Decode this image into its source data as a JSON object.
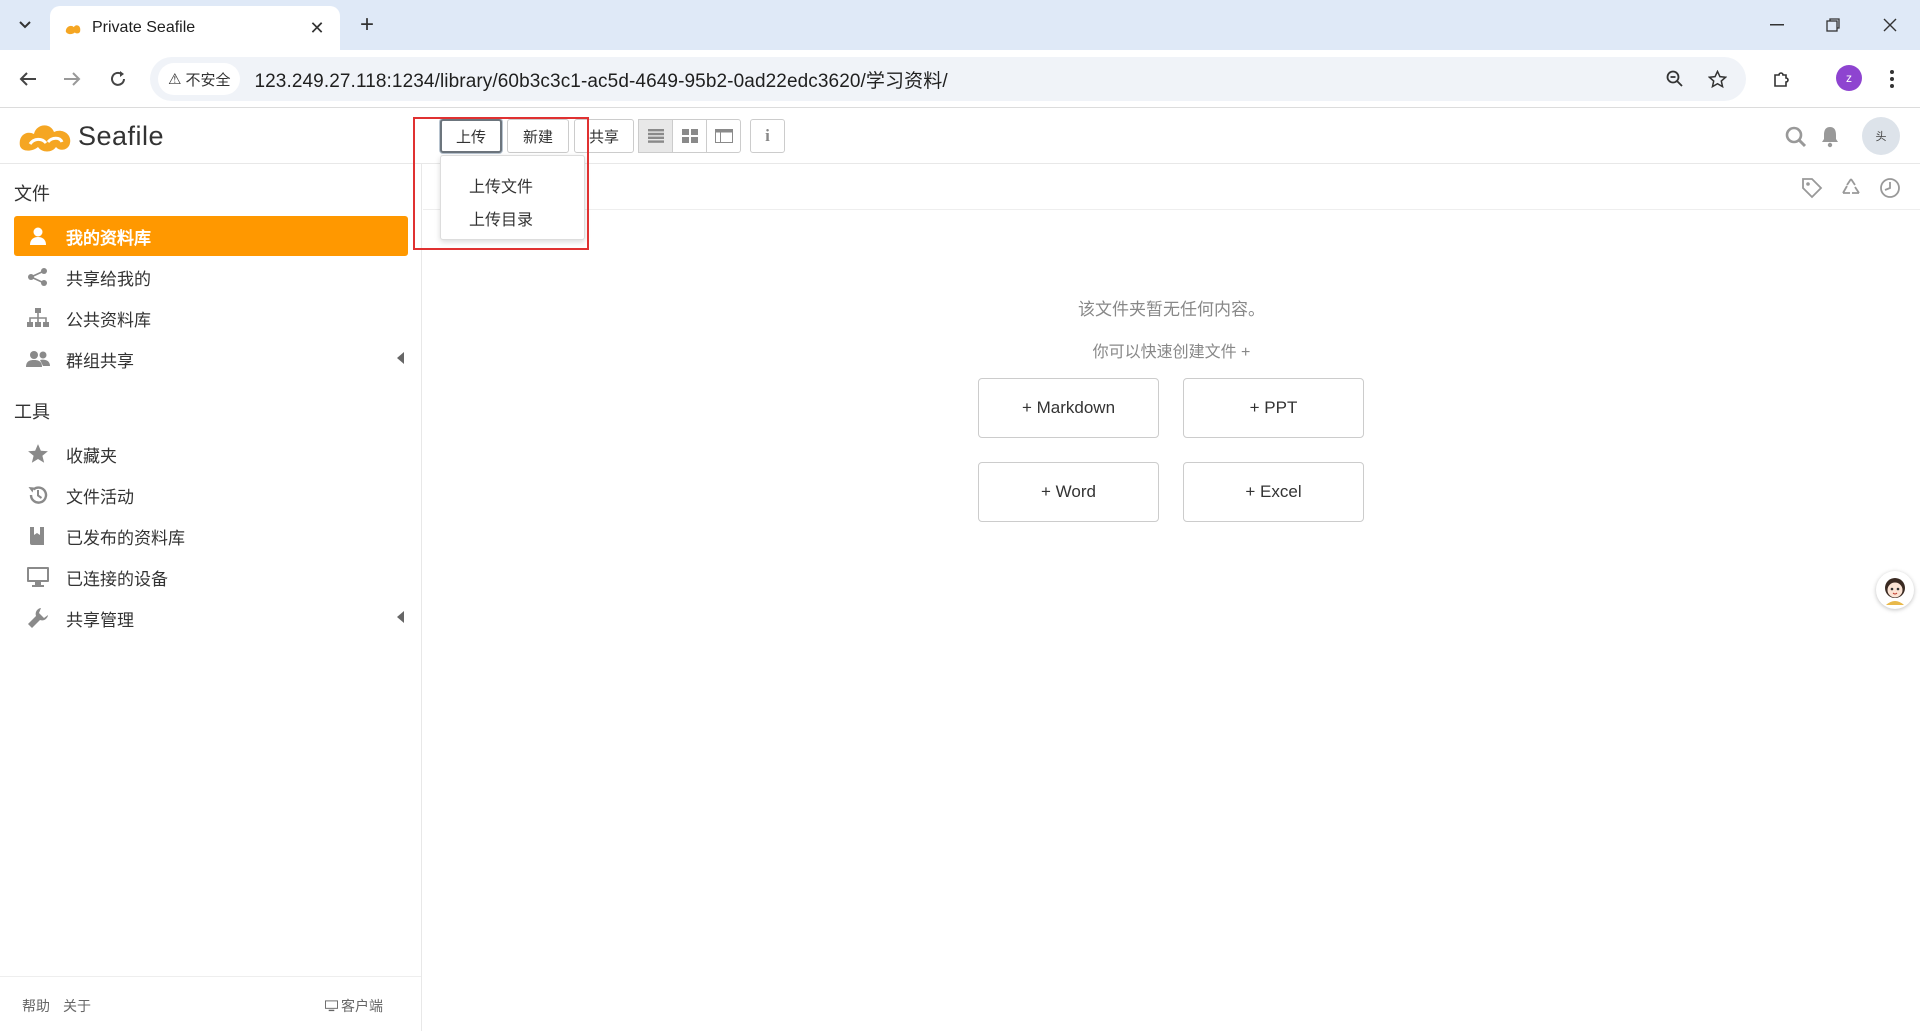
{
  "browser": {
    "tab_title": "Private Seafile",
    "security_label": "不安全",
    "url": "123.249.27.118:1234/library/60b3c3c1-ac5d-4649-95b2-0ad22edc3620/学习资料/",
    "profile_initial": "z"
  },
  "header": {
    "logo_text": "Seafile",
    "upload_label": "上传",
    "new_label": "新建",
    "share_label": "共享",
    "avatar_alt": "头"
  },
  "upload_menu": {
    "items": [
      "上传文件",
      "上传目录"
    ]
  },
  "sidebar": {
    "files_heading": "文件",
    "files_items": [
      {
        "label": "我的资料库",
        "icon": "user-icon",
        "active": true
      },
      {
        "label": "共享给我的",
        "icon": "share-nodes-icon"
      },
      {
        "label": "公共资料库",
        "icon": "sitemap-icon"
      },
      {
        "label": "群组共享",
        "icon": "group-icon"
      }
    ],
    "tools_heading": "工具",
    "tools_items": [
      {
        "label": "收藏夹",
        "icon": "star-icon"
      },
      {
        "label": "文件活动",
        "icon": "history-icon"
      },
      {
        "label": "已发布的资料库",
        "icon": "book-icon"
      },
      {
        "label": "已连接的设备",
        "icon": "monitor-icon"
      },
      {
        "label": "共享管理",
        "icon": "wrench-icon"
      }
    ],
    "footer": {
      "help": "帮助",
      "about": "关于",
      "client": "客户端"
    }
  },
  "main": {
    "empty_title": "该文件夹暂无任何内容。",
    "empty_sub": "你可以快速创建文件 +",
    "create_buttons": [
      "+ Markdown",
      "+ PPT",
      "+ Word",
      "+ Excel"
    ]
  },
  "colors": {
    "accent": "#ff9800",
    "highlight_box": "#e03131"
  }
}
